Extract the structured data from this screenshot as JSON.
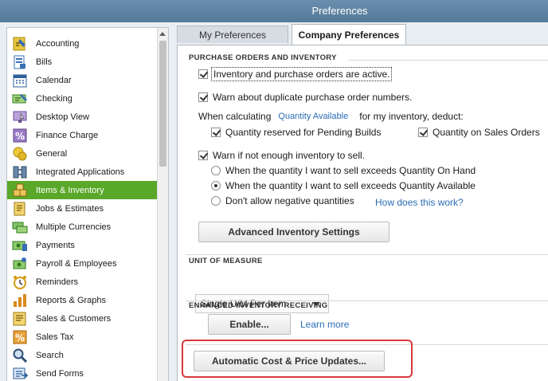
{
  "window": {
    "title": "Preferences"
  },
  "sidebar": {
    "items": [
      {
        "label": "Accounting",
        "icon": "accounting-icon",
        "selected": false
      },
      {
        "label": "Bills",
        "icon": "bills-icon",
        "selected": false
      },
      {
        "label": "Calendar",
        "icon": "calendar-icon",
        "selected": false
      },
      {
        "label": "Checking",
        "icon": "checking-icon",
        "selected": false
      },
      {
        "label": "Desktop View",
        "icon": "desktop-view-icon",
        "selected": false
      },
      {
        "label": "Finance Charge",
        "icon": "finance-charge-icon",
        "selected": false
      },
      {
        "label": "General",
        "icon": "general-icon",
        "selected": false
      },
      {
        "label": "Integrated Applications",
        "icon": "integrated-applications-icon",
        "selected": false
      },
      {
        "label": "Items & Inventory",
        "icon": "items-inventory-icon",
        "selected": true
      },
      {
        "label": "Jobs & Estimates",
        "icon": "jobs-estimates-icon",
        "selected": false
      },
      {
        "label": "Multiple Currencies",
        "icon": "multiple-currencies-icon",
        "selected": false
      },
      {
        "label": "Payments",
        "icon": "payments-icon",
        "selected": false
      },
      {
        "label": "Payroll & Employees",
        "icon": "payroll-employees-icon",
        "selected": false
      },
      {
        "label": "Reminders",
        "icon": "reminders-icon",
        "selected": false
      },
      {
        "label": "Reports & Graphs",
        "icon": "reports-graphs-icon",
        "selected": false
      },
      {
        "label": "Sales & Customers",
        "icon": "sales-customers-icon",
        "selected": false
      },
      {
        "label": "Sales Tax",
        "icon": "sales-tax-icon",
        "selected": false
      },
      {
        "label": "Search",
        "icon": "search-icon",
        "selected": false
      },
      {
        "label": "Send Forms",
        "icon": "send-forms-icon",
        "selected": false
      }
    ]
  },
  "tabs": {
    "my": "My Preferences",
    "company": "Company Preferences",
    "active": "company"
  },
  "purchase_orders": {
    "title": "PURCHASE ORDERS AND INVENTORY",
    "inventory_active": {
      "label": "Inventory and purchase orders are active.",
      "checked": true
    },
    "warn_duplicate": {
      "label": "Warn about duplicate purchase order numbers.",
      "checked": true
    },
    "calc_prefix": "When calculating",
    "calc_mode": "Quantity Available",
    "calc_suffix": "for my inventory, deduct:",
    "qty_pending_builds": {
      "label": "Quantity reserved for Pending Builds",
      "checked": true
    },
    "qty_sales_orders": {
      "label": "Quantity on Sales Orders",
      "checked": true
    },
    "warn_not_enough": {
      "label": "Warn if not enough inventory to sell.",
      "checked": true
    },
    "radio_on_hand": {
      "label": "When the quantity I want to sell exceeds Quantity On Hand",
      "checked": false
    },
    "radio_available": {
      "label": "When the quantity I want to sell exceeds Quantity Available",
      "checked": true
    },
    "radio_no_negative": {
      "label": "Don't allow negative quantities",
      "checked": false
    },
    "how_link": "How does this work?",
    "advanced_button": "Advanced Inventory Settings"
  },
  "unit_of_measure": {
    "title": "UNIT OF MEASURE",
    "selected": "Single U/M Per Item"
  },
  "enhanced_receiving": {
    "title": "ENHANCED INVENTORY RECEIVING",
    "enable_button": "Enable...",
    "learn_more": "Learn more"
  },
  "auto_cost_button": "Automatic Cost & Price Updates...",
  "colors": {
    "titlebar": "#5f84a3",
    "selected_item": "#5aa82a",
    "link": "#2a6db5",
    "highlight_box": "#d8383a"
  }
}
